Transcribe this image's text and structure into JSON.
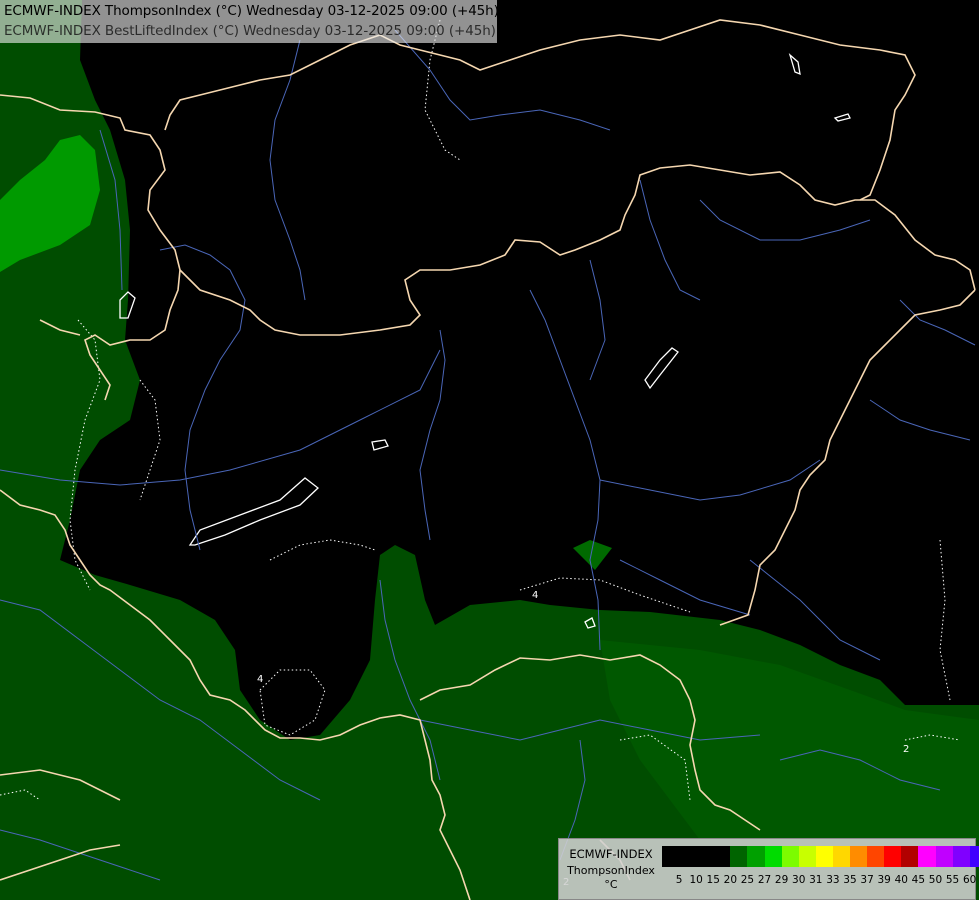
{
  "title": {
    "line1": "ECMWF-INDEX ThompsonIndex (°C) Wednesday 03-12-2025 09:00 (+45h)",
    "line2": "ECMWF-INDEX BestLiftedIndex (°C) Wednesday 03-12-2025 09:00 (+45h)"
  },
  "legend": {
    "model": "ECMWF-INDEX",
    "parameter": "ThompsonIndex",
    "unit": "°C",
    "ticks": [
      "5",
      "10",
      "15",
      "20",
      "25",
      "27",
      "29",
      "30",
      "31",
      "33",
      "35",
      "37",
      "39",
      "40",
      "45",
      "50",
      "55",
      "60"
    ],
    "colors": [
      "#000000",
      "#000000",
      "#000000",
      "#000000",
      "#006400",
      "#00a000",
      "#00dc00",
      "#7cfc00",
      "#c8ff00",
      "#ffff00",
      "#ffd700",
      "#ff8c00",
      "#ff4500",
      "#ff0000",
      "#b20000",
      "#ff00ff",
      "#c000ff",
      "#8000ff",
      "#4000ff",
      "#0000ff"
    ]
  },
  "contour_labels": [
    "4",
    "4",
    "2",
    "2"
  ],
  "map_colors": {
    "background": "#000000",
    "field_low": "#004d00",
    "field_mid": "#007f00",
    "field_high": "#00a500",
    "borders": "#f5d7b0",
    "rivers": "#4a66b8",
    "contours": "#ffffff"
  }
}
